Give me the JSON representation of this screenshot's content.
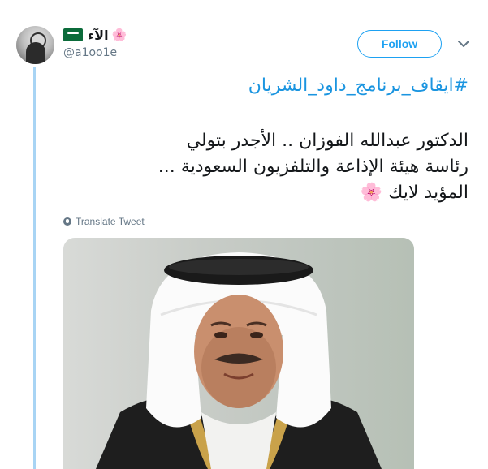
{
  "user": {
    "display_name": "الآء",
    "name_emoji": "🌸",
    "flag_icon": "saudi-flag-icon",
    "handle": "@a1oo1e"
  },
  "follow_button": {
    "label": "Follow",
    "color": "#1da1f2"
  },
  "tweet": {
    "hashtag": "#ايقاف_برنامج_داود_الشريان",
    "lines": [
      "الدكتور عبدالله الفوزان .. الأجدر بتولي",
      "رئاسة هيئة الإذاعة والتلفزيون السعودية ...",
      "المؤيد لايك 🌸"
    ],
    "translate_label": "Translate Tweet"
  },
  "colors": {
    "accent": "#1da1f2",
    "hashtag": "#1b95e0",
    "thread_line": "#a8d4f4",
    "muted": "#657786"
  }
}
